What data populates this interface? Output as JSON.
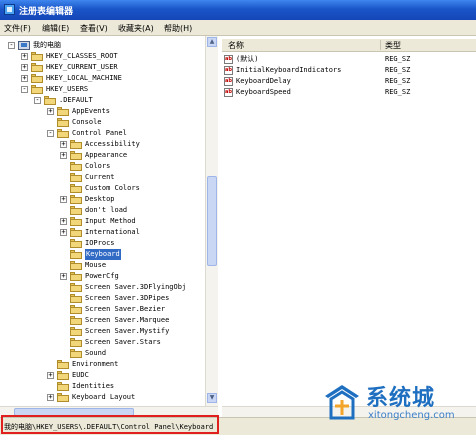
{
  "window": {
    "title": "注册表编辑器"
  },
  "menu": [
    {
      "label": "文件(F)"
    },
    {
      "label": "编辑(E)"
    },
    {
      "label": "查看(V)"
    },
    {
      "label": "收藏夹(A)"
    },
    {
      "label": "帮助(H)"
    }
  ],
  "tree": [
    {
      "label": "我的电脑",
      "depth": 0,
      "expander": "-",
      "icon": "computer-icon"
    },
    {
      "label": "HKEY_CLASSES_ROOT",
      "depth": 1,
      "expander": "+",
      "icon": "folder-icon"
    },
    {
      "label": "HKEY_CURRENT_USER",
      "depth": 1,
      "expander": "+",
      "icon": "folder-icon"
    },
    {
      "label": "HKEY_LOCAL_MACHINE",
      "depth": 1,
      "expander": "+",
      "icon": "folder-icon"
    },
    {
      "label": "HKEY_USERS",
      "depth": 1,
      "expander": "-",
      "icon": "folder-icon"
    },
    {
      "label": ".DEFAULT",
      "depth": 2,
      "expander": "-",
      "icon": "folder-icon"
    },
    {
      "label": "AppEvents",
      "depth": 3,
      "expander": "+",
      "icon": "folder-icon"
    },
    {
      "label": "Console",
      "depth": 3,
      "expander": "",
      "icon": "folder-icon"
    },
    {
      "label": "Control Panel",
      "depth": 3,
      "expander": "-",
      "icon": "folder-icon"
    },
    {
      "label": "Accessibility",
      "depth": 4,
      "expander": "+",
      "icon": "folder-icon"
    },
    {
      "label": "Appearance",
      "depth": 4,
      "expander": "+",
      "icon": "folder-icon"
    },
    {
      "label": "Colors",
      "depth": 4,
      "expander": "",
      "icon": "folder-icon"
    },
    {
      "label": "Current",
      "depth": 4,
      "expander": "",
      "icon": "folder-icon"
    },
    {
      "label": "Custom Colors",
      "depth": 4,
      "expander": "",
      "icon": "folder-icon"
    },
    {
      "label": "Desktop",
      "depth": 4,
      "expander": "+",
      "icon": "folder-icon"
    },
    {
      "label": "don't load",
      "depth": 4,
      "expander": "",
      "icon": "folder-icon"
    },
    {
      "label": "Input Method",
      "depth": 4,
      "expander": "+",
      "icon": "folder-icon"
    },
    {
      "label": "International",
      "depth": 4,
      "expander": "+",
      "icon": "folder-icon"
    },
    {
      "label": "IOProcs",
      "depth": 4,
      "expander": "",
      "icon": "folder-icon"
    },
    {
      "label": "Keyboard",
      "depth": 4,
      "expander": "",
      "icon": "folder-icon",
      "selected": true
    },
    {
      "label": "Mouse",
      "depth": 4,
      "expander": "",
      "icon": "folder-icon"
    },
    {
      "label": "PowerCfg",
      "depth": 4,
      "expander": "+",
      "icon": "folder-icon"
    },
    {
      "label": "Screen Saver.3DFlyingObj",
      "depth": 4,
      "expander": "",
      "icon": "folder-icon"
    },
    {
      "label": "Screen Saver.3DPipes",
      "depth": 4,
      "expander": "",
      "icon": "folder-icon"
    },
    {
      "label": "Screen Saver.Bezier",
      "depth": 4,
      "expander": "",
      "icon": "folder-icon"
    },
    {
      "label": "Screen Saver.Marquee",
      "depth": 4,
      "expander": "",
      "icon": "folder-icon"
    },
    {
      "label": "Screen Saver.Mystify",
      "depth": 4,
      "expander": "",
      "icon": "folder-icon"
    },
    {
      "label": "Screen Saver.Stars",
      "depth": 4,
      "expander": "",
      "icon": "folder-icon"
    },
    {
      "label": "Sound",
      "depth": 4,
      "expander": "",
      "icon": "folder-icon"
    },
    {
      "label": "Environment",
      "depth": 3,
      "expander": "",
      "icon": "folder-icon"
    },
    {
      "label": "EUDC",
      "depth": 3,
      "expander": "+",
      "icon": "folder-icon"
    },
    {
      "label": "Identities",
      "depth": 3,
      "expander": "",
      "icon": "folder-icon"
    },
    {
      "label": "Keyboard Layout",
      "depth": 3,
      "expander": "+",
      "icon": "folder-icon"
    }
  ],
  "list": {
    "headers": {
      "name": "名称",
      "type": "类型"
    },
    "rows": [
      {
        "name": "(默认)",
        "type": "REG_SZ",
        "icon": "string-value-icon"
      },
      {
        "name": "InitialKeyboardIndicators",
        "type": "REG_SZ",
        "icon": "string-value-icon"
      },
      {
        "name": "KeyboardDelay",
        "type": "REG_SZ",
        "icon": "string-value-icon"
      },
      {
        "name": "KeyboardSpeed",
        "type": "REG_SZ",
        "icon": "string-value-icon"
      }
    ]
  },
  "status": {
    "path": "我的电脑\\HKEY_USERS\\.DEFAULT\\Control Panel\\Keyboard"
  },
  "watermark": {
    "brand": "系统城",
    "domain": "xitongcheng.com"
  },
  "colors": {
    "selection": "#316ac5",
    "highlight_box": "#e0201e",
    "titlebar": "#1a55c8",
    "brand": "#1f6fc1"
  }
}
